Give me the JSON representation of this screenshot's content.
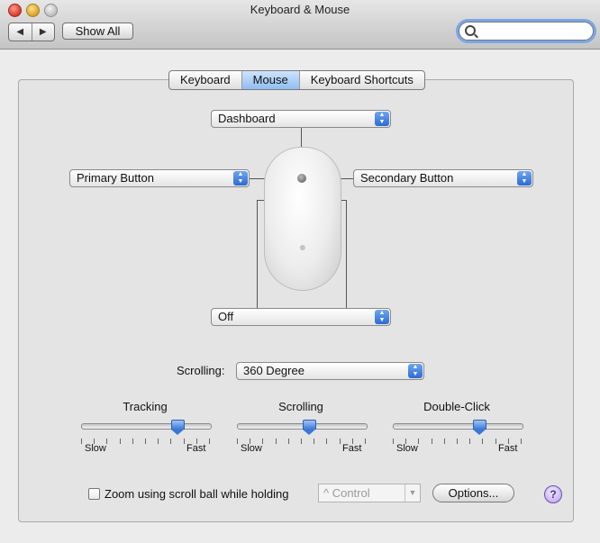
{
  "window": {
    "title": "Keyboard & Mouse"
  },
  "toolbar": {
    "back_glyph": "◀",
    "forward_glyph": "▶",
    "show_all_label": "Show All",
    "search": {
      "value": "",
      "placeholder": ""
    }
  },
  "tabs": [
    {
      "label": "Keyboard",
      "active": false
    },
    {
      "label": "Mouse",
      "active": true
    },
    {
      "label": "Keyboard Shortcuts",
      "active": false
    }
  ],
  "mouse_buttons": {
    "top": "Dashboard",
    "left": "Primary Button",
    "right": "Secondary Button",
    "bottom": "Off"
  },
  "scrolling_row": {
    "label": "Scrolling:",
    "value": "360 Degree"
  },
  "sliders": [
    {
      "title": "Tracking",
      "min_label": "Slow",
      "max_label": "Fast",
      "level": 0.75
    },
    {
      "title": "Scrolling",
      "min_label": "Slow",
      "max_label": "Fast",
      "level": 0.56
    },
    {
      "title": "Double-Click",
      "min_label": "Slow",
      "max_label": "Fast",
      "level": 0.67
    }
  ],
  "zoom": {
    "checkbox_label": "Zoom using scroll ball while holding",
    "checked": false,
    "modifier_value": "^ Control"
  },
  "options_button_label": "Options...",
  "help_glyph": "?",
  "colors": {
    "accent_blue": "#3a77d6",
    "selected_tab": "#8fbdf2",
    "panel_bg": "#e4e4e4"
  }
}
